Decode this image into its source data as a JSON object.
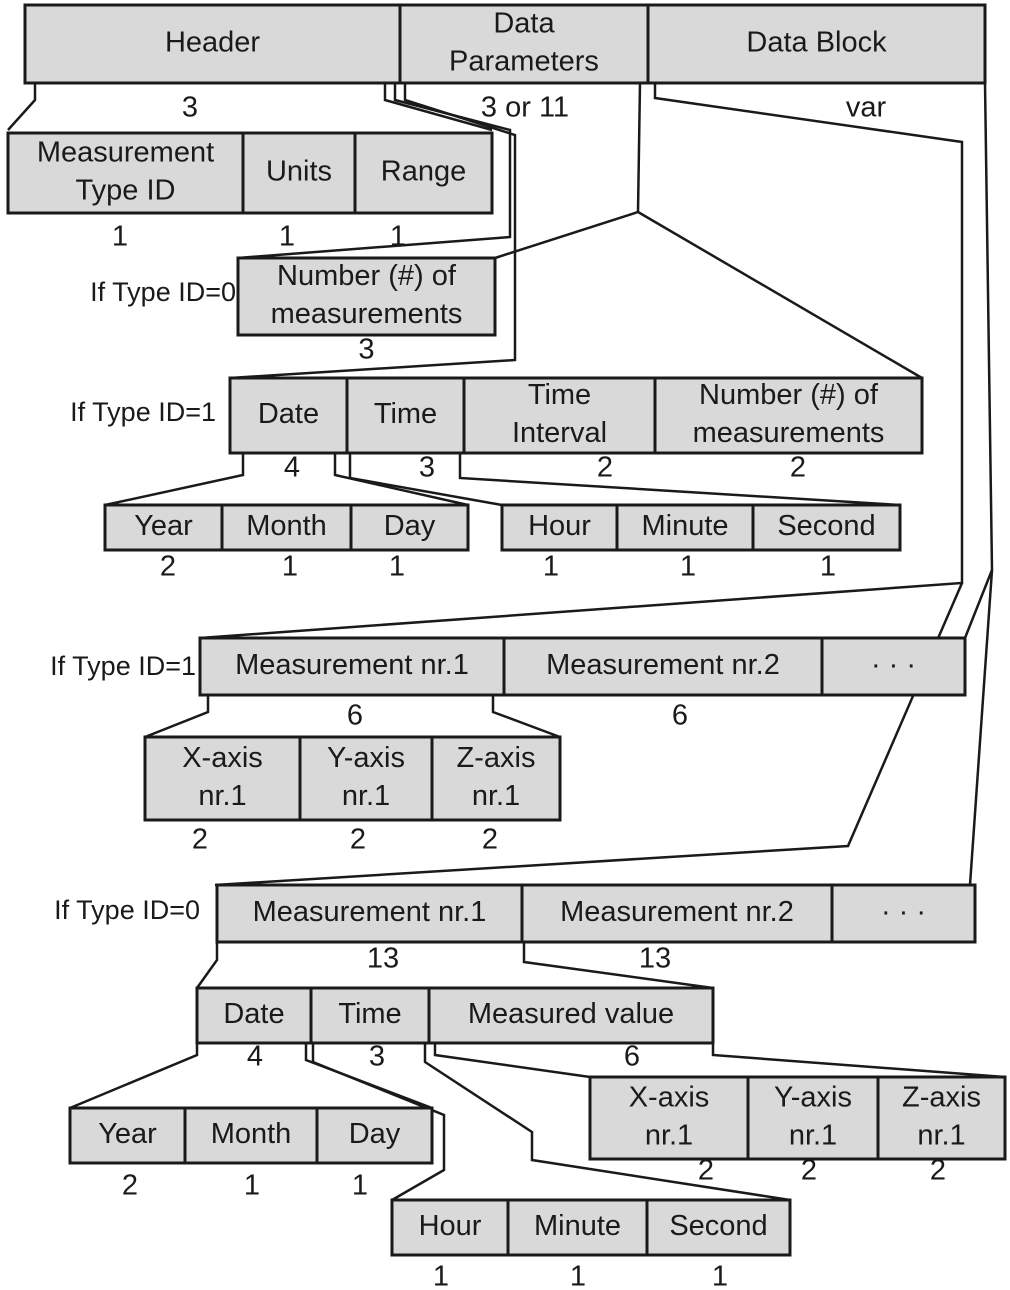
{
  "title": "Packet structure diagram",
  "top_level": [
    {
      "id": "header",
      "label": [
        "Header"
      ],
      "size": "3"
    },
    {
      "id": "data-parameters",
      "label": [
        "Data",
        "Parameters"
      ],
      "size": "3 or 11"
    },
    {
      "id": "data-block",
      "label": [
        "Data Block"
      ],
      "size": "var"
    }
  ],
  "header_fields": [
    {
      "label": [
        "Measurement",
        "Type ID"
      ],
      "size": "1"
    },
    {
      "label": [
        "Units"
      ],
      "size": "1"
    },
    {
      "label": [
        "Range"
      ],
      "size": "1"
    }
  ],
  "params_type0": {
    "condition": "If Type ID=0",
    "fields": [
      {
        "label": [
          "Number (#) of",
          "measurements"
        ],
        "size": "3"
      }
    ]
  },
  "params_type1": {
    "condition": "If Type ID=1",
    "fields": [
      {
        "label": [
          "Date"
        ],
        "size": "4"
      },
      {
        "label": [
          "Time"
        ],
        "size": "3"
      },
      {
        "label": [
          "Time",
          "Interval"
        ],
        "size": "2"
      },
      {
        "label": [
          "Number (#) of",
          "measurements"
        ],
        "size": "2"
      }
    ],
    "date_fields": [
      {
        "label": [
          "Year"
        ],
        "size": "2"
      },
      {
        "label": [
          "Month"
        ],
        "size": "1"
      },
      {
        "label": [
          "Day"
        ],
        "size": "1"
      }
    ],
    "time_fields": [
      {
        "label": [
          "Hour"
        ],
        "size": "1"
      },
      {
        "label": [
          "Minute"
        ],
        "size": "1"
      },
      {
        "label": [
          "Second"
        ],
        "size": "1"
      }
    ]
  },
  "block_type1": {
    "condition": "If Type ID=1",
    "fields": [
      {
        "label": [
          "Measurement nr.1"
        ],
        "size": "6"
      },
      {
        "label": [
          "Measurement nr.2"
        ],
        "size": "6"
      },
      {
        "label": [
          "· · ·"
        ],
        "size": ""
      }
    ],
    "axis_fields": [
      {
        "label": [
          "X-axis",
          "nr.1"
        ],
        "size": "2"
      },
      {
        "label": [
          "Y-axis",
          "nr.1"
        ],
        "size": "2"
      },
      {
        "label": [
          "Z-axis",
          "nr.1"
        ],
        "size": "2"
      }
    ]
  },
  "block_type0": {
    "condition": "If Type ID=0",
    "fields": [
      {
        "label": [
          "Measurement nr.1"
        ],
        "size": "13"
      },
      {
        "label": [
          "Measurement nr.2"
        ],
        "size": "13"
      },
      {
        "label": [
          "· · ·"
        ],
        "size": ""
      }
    ],
    "sub_fields": [
      {
        "label": [
          "Date"
        ],
        "size": "4"
      },
      {
        "label": [
          "Time"
        ],
        "size": "3"
      },
      {
        "label": [
          "Measured value"
        ],
        "size": "6"
      }
    ],
    "date_fields": [
      {
        "label": [
          "Year"
        ],
        "size": "2"
      },
      {
        "label": [
          "Month"
        ],
        "size": "1"
      },
      {
        "label": [
          "Day"
        ],
        "size": "1"
      }
    ],
    "time_fields": [
      {
        "label": [
          "Hour"
        ],
        "size": "1"
      },
      {
        "label": [
          "Minute"
        ],
        "size": "1"
      },
      {
        "label": [
          "Second"
        ],
        "size": "1"
      }
    ],
    "axis_fields": [
      {
        "label": [
          "X-axis",
          "nr.1"
        ],
        "size": "2"
      },
      {
        "label": [
          "Y-axis",
          "nr.1"
        ],
        "size": "2"
      },
      {
        "label": [
          "Z-axis",
          "nr.1"
        ],
        "size": "2"
      }
    ]
  }
}
